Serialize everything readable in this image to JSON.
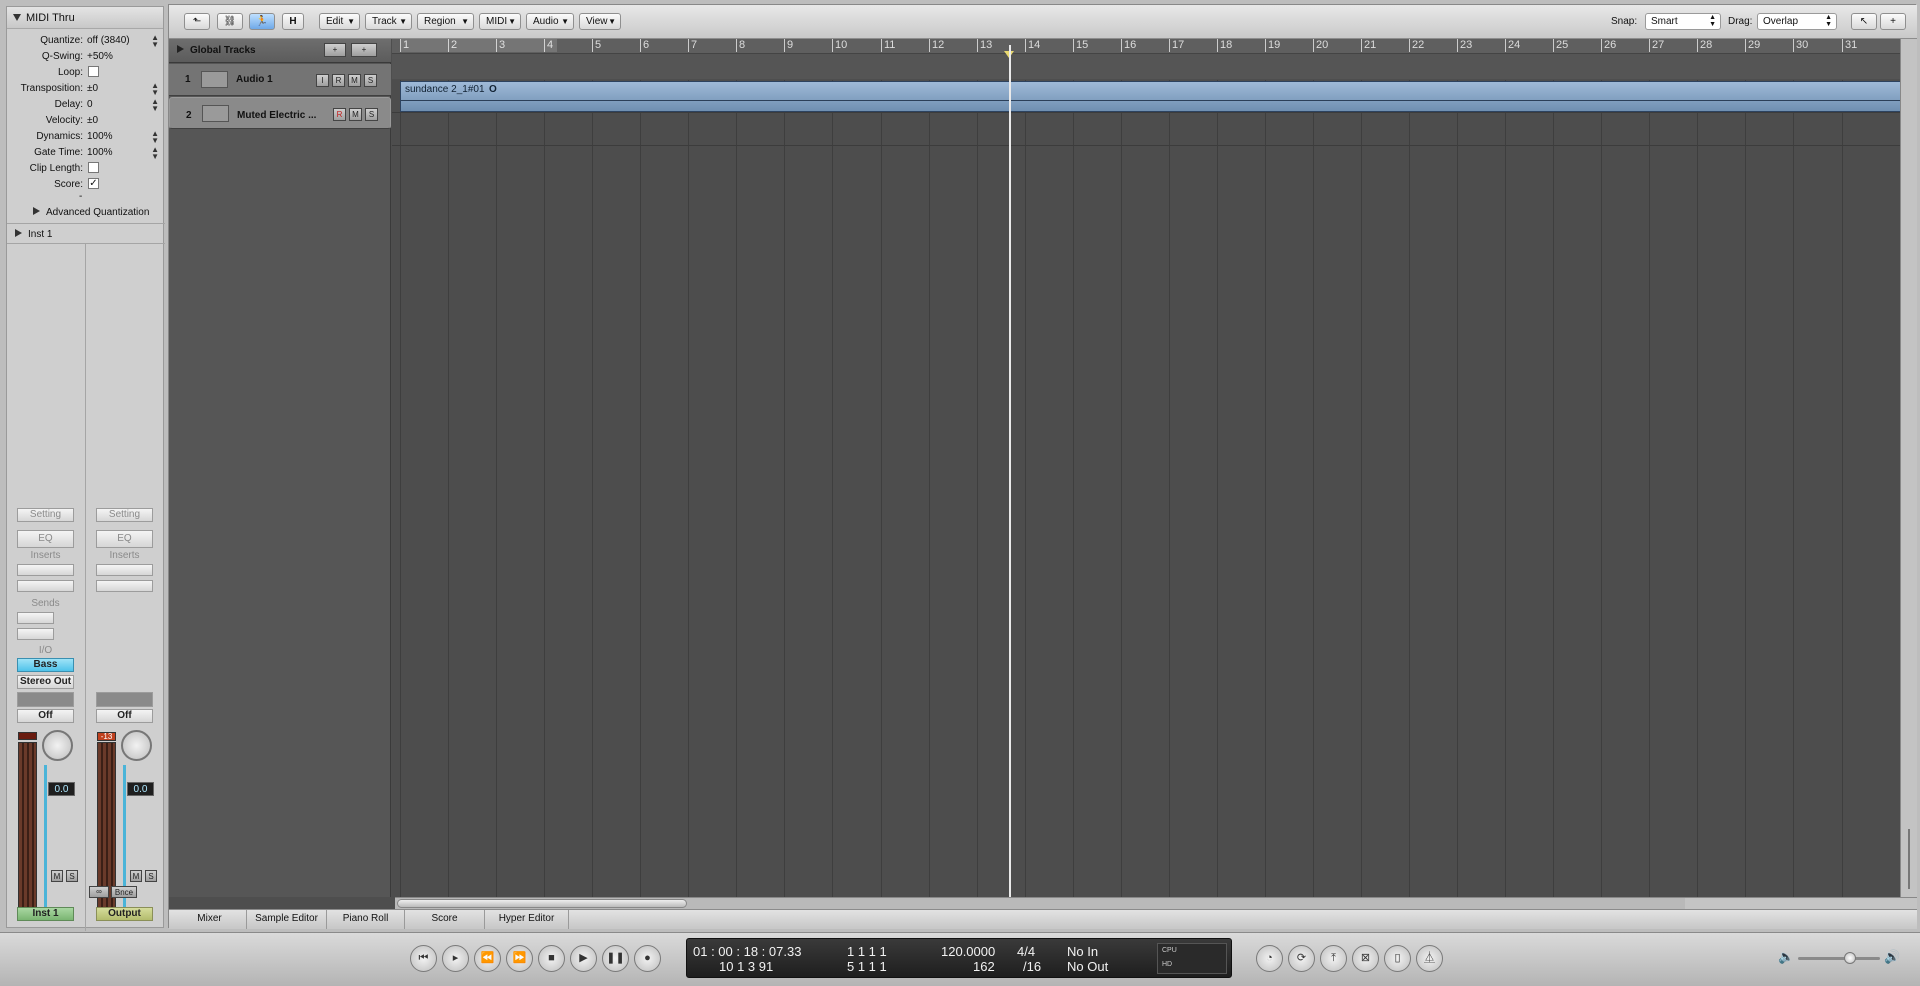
{
  "inspector": {
    "header": "MIDI Thru",
    "params": [
      {
        "label": "Quantize:",
        "value": "off (3840)",
        "type": "stepper"
      },
      {
        "label": "Q-Swing:",
        "value": "+50%",
        "type": "text"
      },
      {
        "label": "Loop:",
        "value": "",
        "type": "check"
      },
      {
        "label": "Transposition:",
        "value": "±0",
        "type": "stepper"
      },
      {
        "label": "Delay:",
        "value": "0",
        "type": "stepper"
      },
      {
        "label": "Velocity:",
        "value": "±0",
        "type": "text"
      },
      {
        "label": "Dynamics:",
        "value": "100%",
        "type": "stepper"
      },
      {
        "label": "Gate Time:",
        "value": "100%",
        "type": "stepper"
      },
      {
        "label": "Clip Length:",
        "value": "",
        "type": "check"
      },
      {
        "label": "Score:",
        "value": "✓",
        "type": "check"
      }
    ],
    "dash": "-",
    "advanced": "Advanced Quantization",
    "instrument_section": "Inst 1",
    "strip_left": {
      "setting": "Setting",
      "eq": "EQ",
      "inserts": "Inserts",
      "sends": "Sends",
      "io": "I/O",
      "input": "Bass",
      "output": "Stereo Out",
      "automation": "Off",
      "peak": "",
      "fader_value": "0.0",
      "mute": "M",
      "solo": "S",
      "name": "Inst 1"
    },
    "strip_right": {
      "setting": "Setting",
      "eq": "EQ",
      "inserts": "Inserts",
      "automation": "Off",
      "peak": "-13",
      "fader_value": "0.0",
      "mute": "M",
      "solo": "S",
      "bounce": "Bnce",
      "name": "Output"
    }
  },
  "toolbar": {
    "back_icon": "arrow-up-left-icon",
    "link_icon": "link-icon",
    "catch_icon": "running-man-icon",
    "hide_label": "H",
    "menus": [
      "Edit",
      "Track",
      "Region",
      "MIDI",
      "Audio",
      "View"
    ],
    "snap_label": "Snap:",
    "snap_value": "Smart",
    "drag_label": "Drag:",
    "drag_value": "Overlap",
    "pointer_tool": "pointer-icon",
    "pencil_tool": "crosshair-icon"
  },
  "global_tracks": {
    "label": "Global Tracks",
    "add": "+",
    "add_folder": "+"
  },
  "tracks": [
    {
      "num": "1",
      "name": "Audio 1",
      "buttons": [
        "I",
        "R",
        "M",
        "S"
      ]
    },
    {
      "num": "2",
      "name": "Muted Electric ...",
      "buttons": [
        "R",
        "M",
        "S"
      ]
    }
  ],
  "ruler": {
    "bars": [
      "1",
      "2",
      "3",
      "4",
      "5",
      "6",
      "7",
      "8",
      "9",
      "10",
      "11",
      "12",
      "13",
      "14",
      "15",
      "16",
      "17",
      "18",
      "19",
      "20",
      "21",
      "22",
      "23",
      "24",
      "25",
      "26",
      "27",
      "28",
      "29",
      "30",
      "31"
    ]
  },
  "region": {
    "name": "sundance 2_1#01",
    "loop_mark": "O"
  },
  "bottom_tabs": [
    "Mixer",
    "Sample Editor",
    "Piano Roll",
    "Score",
    "Hyper Editor"
  ],
  "transport": {
    "smpte": "01 : 00 : 18 : 07.33",
    "bars_line2": "10   1   3   91",
    "position": "1   1   1   1",
    "end_position": "5   1   1   1",
    "tempo": "120.0000",
    "signature": "4/4",
    "division": "162",
    "division_2": "/16",
    "midi_in": "No In",
    "midi_out": "No Out",
    "cpu": "CPU",
    "hd": "HD"
  }
}
